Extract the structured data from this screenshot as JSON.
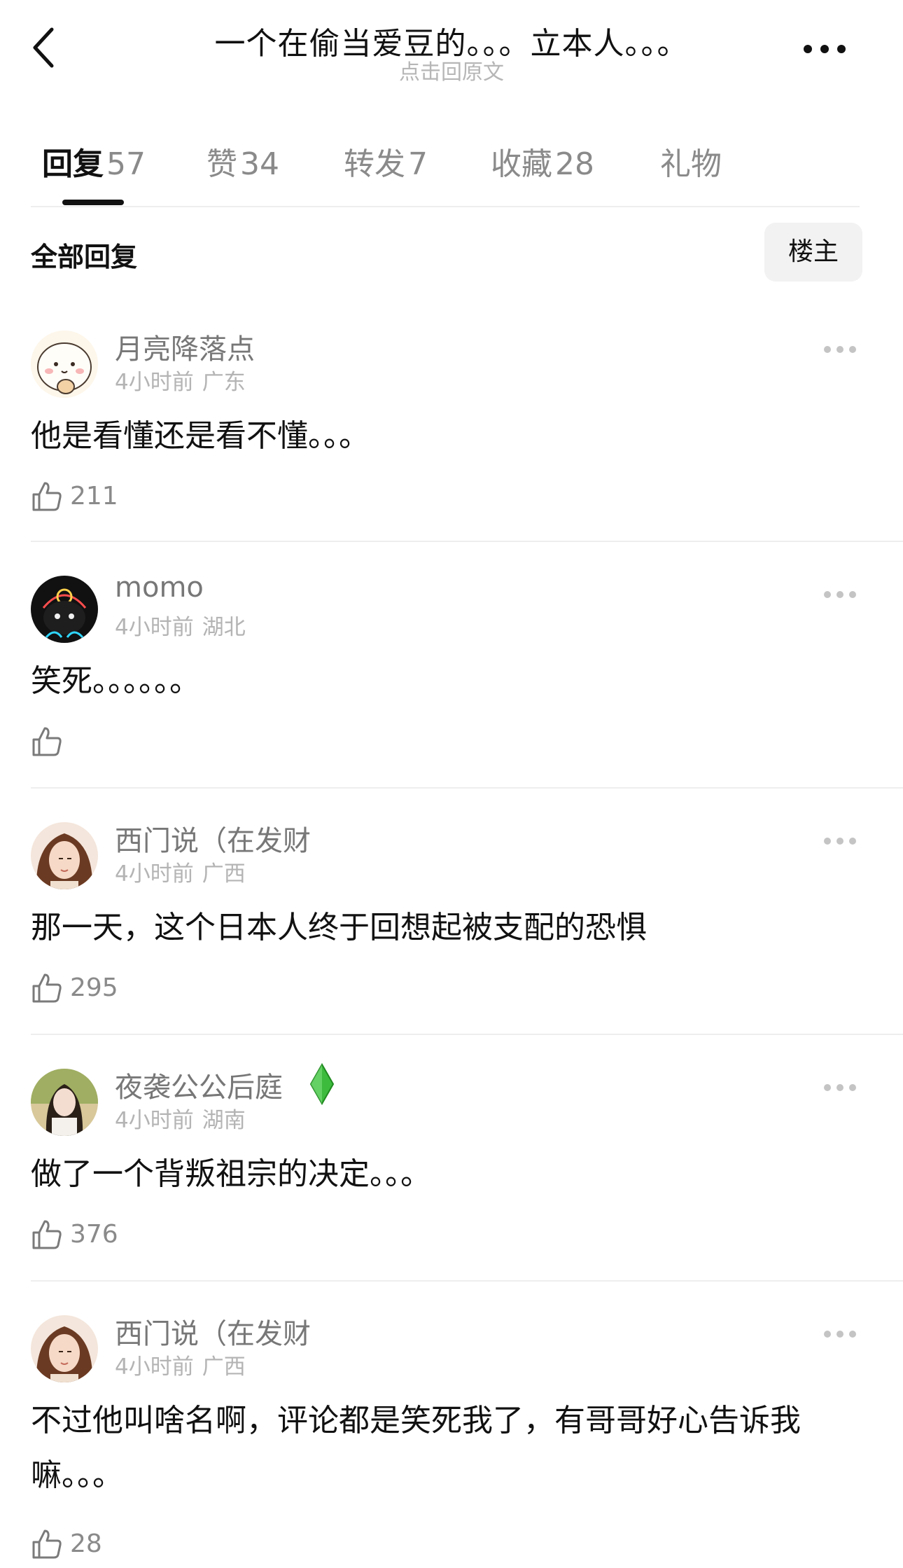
{
  "header": {
    "title": "一个在偷当爱豆的。。。立本人。。。",
    "subtitle": "点击回原文"
  },
  "tabs": [
    {
      "label": "回复",
      "count": "57"
    },
    {
      "label": "赞",
      "count": "34"
    },
    {
      "label": "转发",
      "count": "7"
    },
    {
      "label": "收藏",
      "count": "28"
    },
    {
      "label": "礼物",
      "count": ""
    }
  ],
  "filter": {
    "label": "全部回复",
    "owner_button": "楼主"
  },
  "comments": [
    {
      "user": "月亮降落点",
      "time": "4小时前",
      "location": "广东",
      "text": "他是看懂还是看不懂。。。",
      "likes": "211"
    },
    {
      "user": "momo",
      "time": "4小时前",
      "location": "湖北",
      "text": "笑死。。。。。。",
      "likes": ""
    },
    {
      "user": "西门说（在发财",
      "time": "4小时前",
      "location": "广西",
      "text": "那一天，这个日本人终于回想起被支配的恐惧",
      "likes": "295"
    },
    {
      "user": "夜袭公公后庭",
      "time": "4小时前",
      "location": "湖南",
      "text": "做了一个背叛祖宗的决定。。。",
      "likes": "376"
    },
    {
      "user": "西门说（在发财",
      "time": "4小时前",
      "location": "广西",
      "text": "不过他叫啥名啊，评论都是笑死我了，有哥哥好心告诉我嘛。。。",
      "likes": "28"
    }
  ],
  "colors": {
    "text_primary": "#111111",
    "text_secondary": "#8a8a8a",
    "meta": "#b4b4b4",
    "divider": "#eeeeee",
    "badge_green": "#3dbb3d"
  }
}
